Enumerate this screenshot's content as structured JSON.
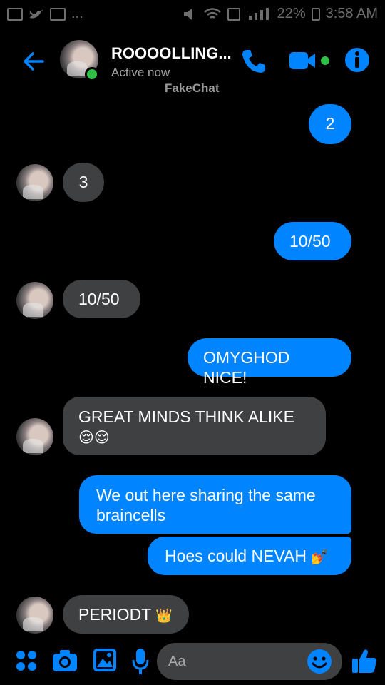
{
  "status_bar": {
    "left_more": "...",
    "battery": "22%",
    "time": "3:58 AM"
  },
  "header": {
    "contact_name": "ROOOOLLING...",
    "status": "Active now",
    "watermark": "FakeChat"
  },
  "messages": [
    {
      "direction": "outgoing",
      "text": "2"
    },
    {
      "direction": "incoming",
      "text": "3"
    },
    {
      "direction": "outgoing",
      "text": "10/50"
    },
    {
      "direction": "incoming",
      "text": "10/50"
    },
    {
      "direction": "outgoing",
      "text": "OMYGHOD NICE!"
    },
    {
      "direction": "incoming",
      "text": "GREAT MINDS THINK ALIKE",
      "emoji": "😌😌"
    },
    {
      "direction": "outgoing",
      "text": "We out here sharing the same braincells"
    },
    {
      "direction": "outgoing",
      "text": "Hoes could NEVAH",
      "emoji": "💅"
    },
    {
      "direction": "incoming",
      "text": "PERIODT",
      "emoji": "👑"
    }
  ],
  "composer": {
    "placeholder": "Aa"
  },
  "colors": {
    "accent": "#0084ff",
    "incoming_bubble": "#3e4042",
    "online": "#30c048",
    "background": "#000000"
  },
  "icons": [
    "back-arrow-icon",
    "phone-icon",
    "video-camera-icon",
    "info-icon",
    "apps-grid-icon",
    "camera-icon",
    "gallery-icon",
    "microphone-icon",
    "emoji-icon",
    "thumbs-up-icon"
  ]
}
